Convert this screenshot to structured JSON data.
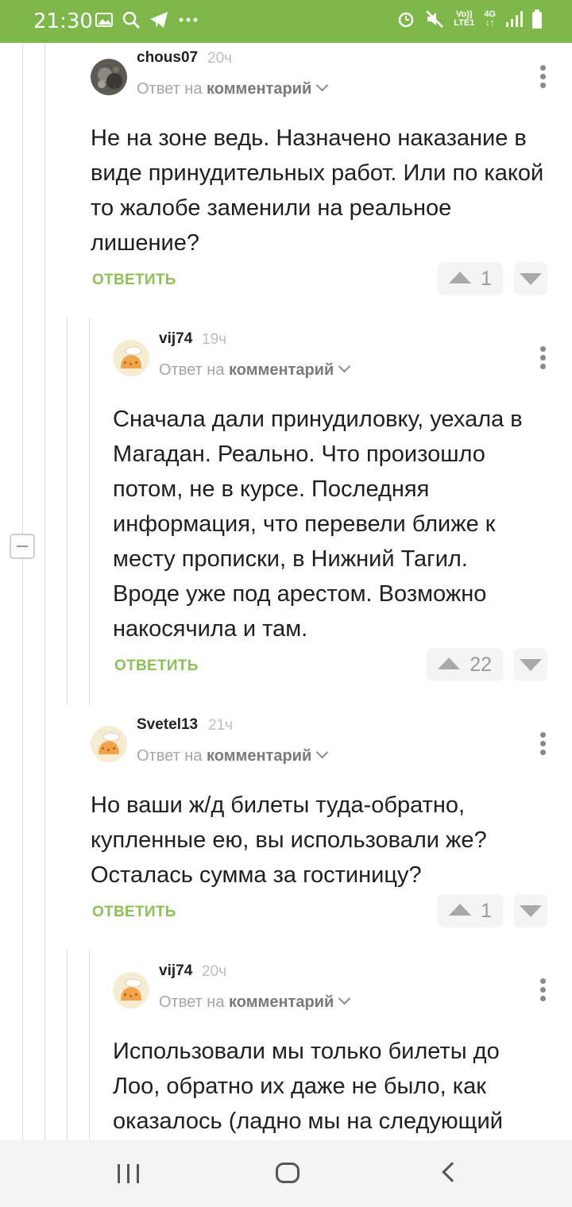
{
  "status_bar": {
    "time": "21:30",
    "network": "4G",
    "volte_line1": "Vo))",
    "volte_line2": "LTE1"
  },
  "colors": {
    "status_bar": "#7eb84a",
    "reply_action": "#8dc05a",
    "username": "#222222",
    "timestamp": "#bdbdbd"
  },
  "comments": [
    {
      "author": "chous07",
      "time": "20ч",
      "reply_prefix": "Ответ на",
      "reply_link": "комментарий",
      "text": "Не на зоне ведь. Назначено наказание в виде принудительных работ. Или по какой то жалобе заменили на реальное лишение?",
      "reply_label": "ОТВЕТИТЬ",
      "votes": "1",
      "avatar_icon": "photo-avatar-icon"
    },
    {
      "author": "vij74",
      "time": "19ч",
      "reply_prefix": "Ответ на",
      "reply_link": "комментарий",
      "text": "Сначала дали принудиловку, уехала в Магадан. Реально. Что произошло потом, не в курсе. Последняя информация, что перевели ближе к месту прописки, в Нижний Тагил. Вроде уже под арестом. Возможно накосячила и там.",
      "reply_label": "ОТВЕТИТЬ",
      "votes": "22",
      "avatar_icon": "default-avatar-icon"
    },
    {
      "author": "Svetel13",
      "time": "21ч",
      "reply_prefix": "Ответ на",
      "reply_link": "комментарий",
      "text": "Но ваши ж/д билеты туда-обратно, купленные ею, вы использовали же? Осталась сумма за гостиницу?",
      "reply_label": "ОТВЕТИТЬ",
      "votes": "1",
      "avatar_icon": "default-avatar-icon"
    },
    {
      "author": "vij74",
      "time": "20ч",
      "reply_prefix": "Ответ на",
      "reply_link": "комментарий",
      "text": "Использовали мы только билеты до Лоо, обратно их даже не было, как оказалось (ладно мы на следующий",
      "avatar_icon": "default-avatar-icon"
    }
  ],
  "nav": {
    "recent": "recent-apps-icon",
    "home": "home-icon",
    "back": "back-icon"
  }
}
